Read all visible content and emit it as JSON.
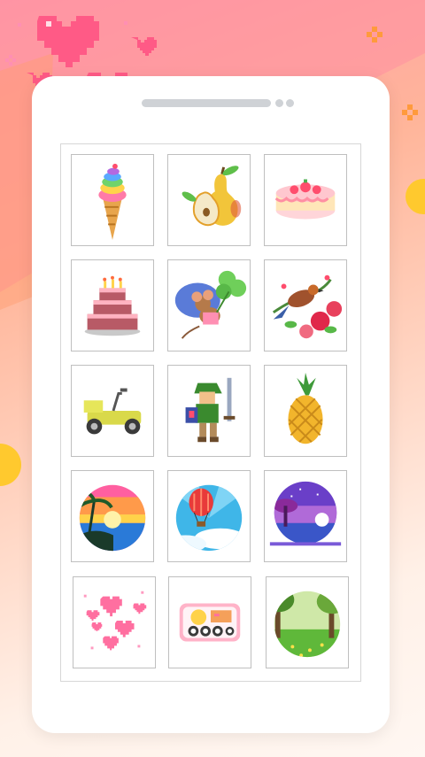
{
  "app": {
    "colors": {
      "accent_pink": "#ff5a86",
      "bg_peach": "#ffd3c0",
      "panel_white": "#ffffff"
    }
  },
  "gallery": {
    "rows": [
      [
        {
          "icon": "rainbow-ice-cream-icon"
        },
        {
          "icon": "pear-icon"
        },
        {
          "icon": "strawberry-cake-icon"
        }
      ],
      [
        {
          "icon": "layered-birthday-cake-icon"
        },
        {
          "icon": "mouse-with-clover-icon"
        },
        {
          "icon": "bird-with-roses-icon"
        }
      ],
      [
        {
          "icon": "lawn-mower-icon"
        },
        {
          "icon": "elf-warrior-icon"
        },
        {
          "icon": "pineapple-icon"
        }
      ],
      [
        {
          "icon": "sunset-island-icon"
        },
        {
          "icon": "hot-air-balloon-icon"
        },
        {
          "icon": "purple-night-landscape-icon"
        }
      ],
      [
        {
          "icon": "pink-hearts-icon"
        },
        {
          "icon": "bento-box-icon"
        },
        {
          "icon": "forest-meadow-icon"
        }
      ]
    ]
  }
}
